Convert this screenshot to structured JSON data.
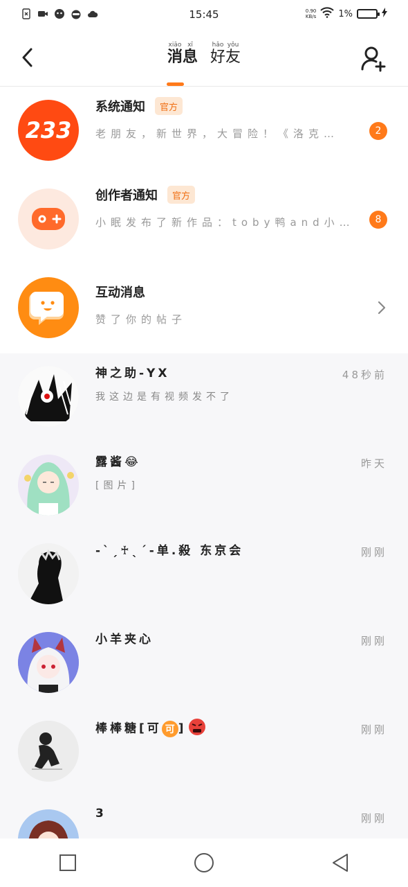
{
  "status_bar": {
    "time": "15:45",
    "network_speed_value": "0.90",
    "network_speed_unit": "KB/s",
    "battery_percent": "1%"
  },
  "header": {
    "tabs": [
      {
        "label": "消息",
        "pinyin": [
          "xiāo",
          "xī"
        ]
      },
      {
        "label": "好友",
        "pinyin": [
          "hǎo",
          "yǒu"
        ]
      }
    ],
    "active_tab": 0
  },
  "official_rows": [
    {
      "avatar_text": "233",
      "title": "系统通知",
      "tag": "官方",
      "subtitle": "老朋友，新世界，大冒险！《洛克…",
      "badge": "2"
    },
    {
      "title": "创作者通知",
      "tag": "官方",
      "subtitle": "小眠发布了新作品：toby鸭and小…",
      "badge": "8"
    },
    {
      "title": "互动消息",
      "subtitle": "赞了你的帖子"
    }
  ],
  "chats": [
    {
      "name": "神之助-YX",
      "message": "我这边是有视频发不了",
      "time": "48秒前"
    },
    {
      "name": "露酱😂",
      "message": "[图片]",
      "time": "昨天"
    },
    {
      "name": "-ˋˏ♰ˎˊ-单.殺 东京会",
      "message": "",
      "time": "刚刚"
    },
    {
      "name": "小羊夹心",
      "message": "",
      "time": "刚刚"
    },
    {
      "name": "棒棒糖[可",
      "name_suffix": "]",
      "emoji_badge": "可",
      "message": "",
      "time": "刚刚"
    },
    {
      "name": "3",
      "message": "",
      "time": "刚刚"
    }
  ],
  "colors": {
    "accent": "#ff7a1a",
    "tag_bg": "#fde7d3",
    "chat_bg": "#f7f7f9"
  }
}
